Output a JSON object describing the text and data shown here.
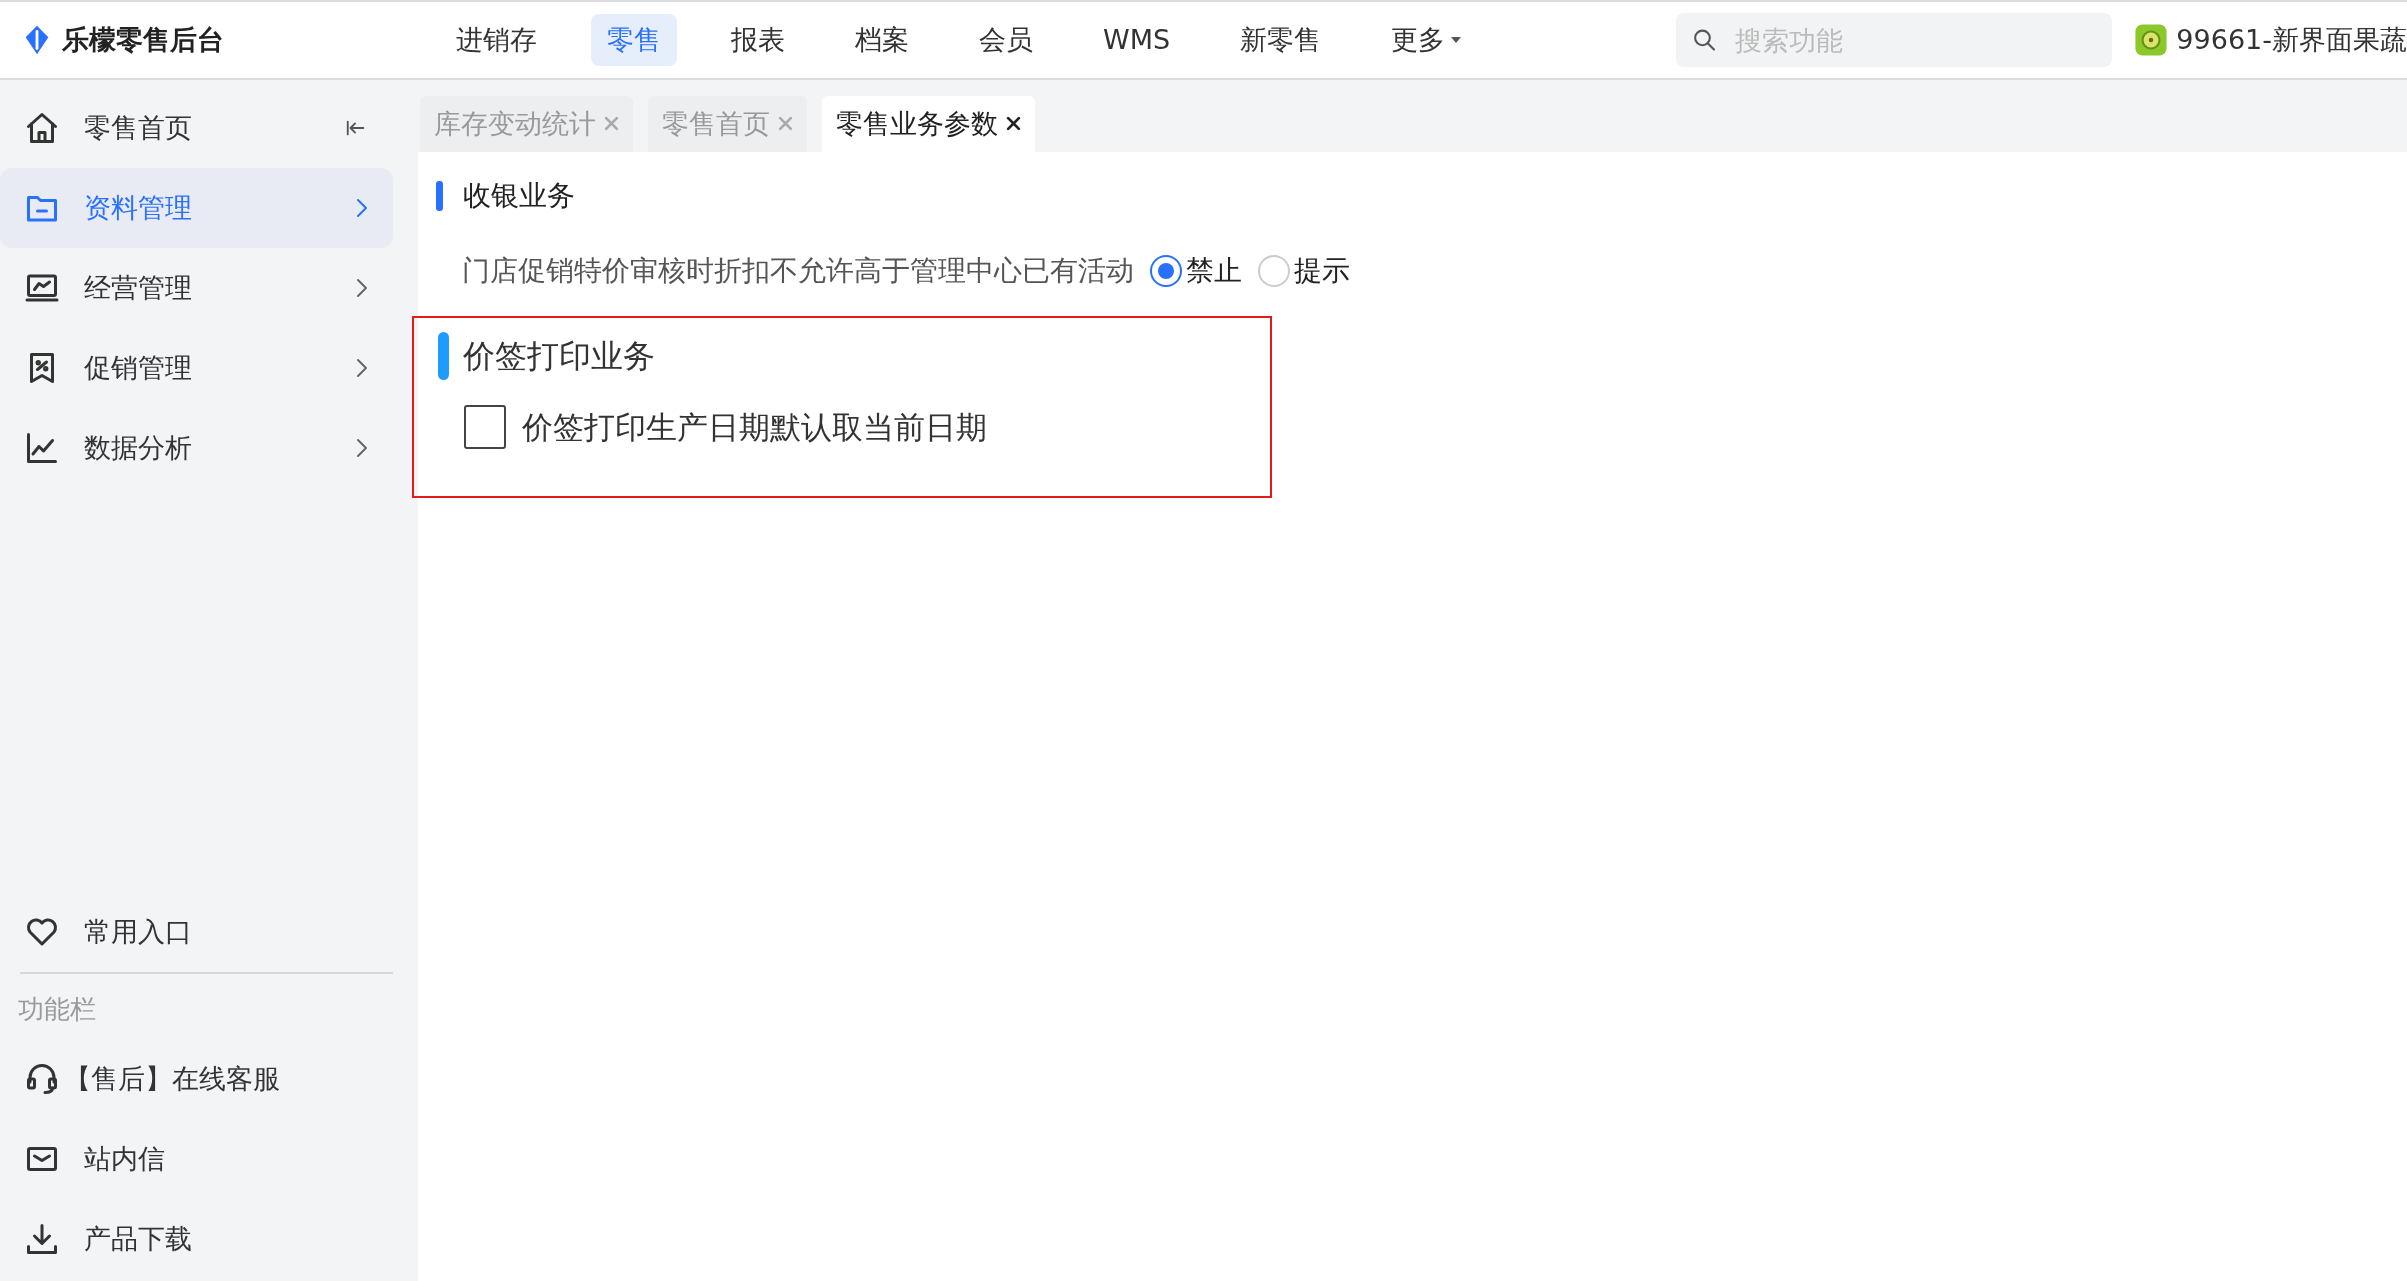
{
  "brand": {
    "name": "乐檬零售后台"
  },
  "top_nav": [
    {
      "label": "进销存",
      "selected": false,
      "dropdown": false
    },
    {
      "label": "零售",
      "selected": true,
      "dropdown": false
    },
    {
      "label": "报表",
      "selected": false,
      "dropdown": false
    },
    {
      "label": "档案",
      "selected": false,
      "dropdown": false
    },
    {
      "label": "会员",
      "selected": false,
      "dropdown": false
    },
    {
      "label": "WMS",
      "selected": false,
      "dropdown": false
    },
    {
      "label": "新零售",
      "selected": false,
      "dropdown": false
    },
    {
      "label": "更多",
      "selected": false,
      "dropdown": true
    }
  ],
  "search": {
    "placeholder": "搜索功能"
  },
  "store": {
    "label": "99661-新界面果蔬"
  },
  "sidebar": {
    "items": [
      {
        "kind": "home",
        "label": "零售首页",
        "selected": false
      },
      {
        "kind": "folder",
        "label": "资料管理",
        "selected": true
      },
      {
        "kind": "monitor",
        "label": "经营管理",
        "selected": false
      },
      {
        "kind": "discount",
        "label": "促销管理",
        "selected": false
      },
      {
        "kind": "chart",
        "label": "数据分析",
        "selected": false
      }
    ],
    "favorites": {
      "label": "常用入口"
    },
    "section_label": "功能栏",
    "tools": [
      {
        "kind": "headset",
        "label": "【售后】在线客服"
      },
      {
        "kind": "mail",
        "label": "站内信"
      },
      {
        "kind": "download",
        "label": "产品下载"
      }
    ]
  },
  "tabs": [
    {
      "label": "库存变动统计",
      "selected": false
    },
    {
      "label": "零售首页",
      "selected": false
    },
    {
      "label": "零售业务参数",
      "selected": true
    }
  ],
  "sections": [
    {
      "title": "收银业务",
      "highlighted": false,
      "settings": [
        {
          "kind": "radio",
          "label": "门店促销特价审核时折扣不允许高于管理中心已有活动",
          "options": [
            {
              "label": "禁止",
              "selected": true
            },
            {
              "label": "提示",
              "selected": false
            }
          ]
        }
      ]
    },
    {
      "title": "价签打印业务",
      "highlighted": true,
      "settings": [
        {
          "kind": "checkbox",
          "label": "价签打印生产日期默认取当前日期",
          "checked": false
        }
      ]
    }
  ]
}
